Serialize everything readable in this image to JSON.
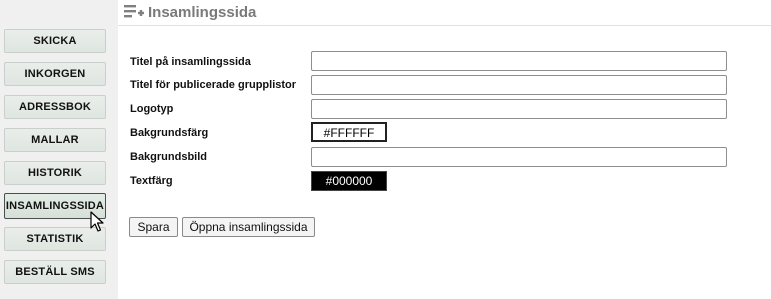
{
  "header": {
    "title": "Insamlingssida",
    "icon": "playlist-add-icon"
  },
  "sidebar": {
    "items": [
      {
        "label": "SKICKA"
      },
      {
        "label": "INKORGEN"
      },
      {
        "label": "ADRESSBOK"
      },
      {
        "label": "MALLAR"
      },
      {
        "label": "HISTORIK"
      },
      {
        "label": "INSAMLINGSSIDA",
        "active": true
      },
      {
        "label": "STATISTIK"
      },
      {
        "label": "BESTÄLL SMS"
      }
    ]
  },
  "form": {
    "page_title_label": "Titel på insamlingssida",
    "page_title_value": "",
    "published_lists_label": "Titel för publicerade grupplistor",
    "published_lists_value": "",
    "logo_label": "Logotyp",
    "logo_value": "",
    "bg_color_label": "Bakgrundsfärg",
    "bg_color_value": "#FFFFFF",
    "bg_image_label": "Bakgrundsbild",
    "bg_image_value": "",
    "text_color_label": "Textfärg",
    "text_color_value": "#000000"
  },
  "actions": {
    "save_label": "Spara",
    "open_page_label": "Öppna insamlingssida"
  },
  "colors": {
    "header_text": "#7a7a7a",
    "sidebar_bg": "#f0f0f0",
    "nav_button": "#e3e9e4"
  }
}
